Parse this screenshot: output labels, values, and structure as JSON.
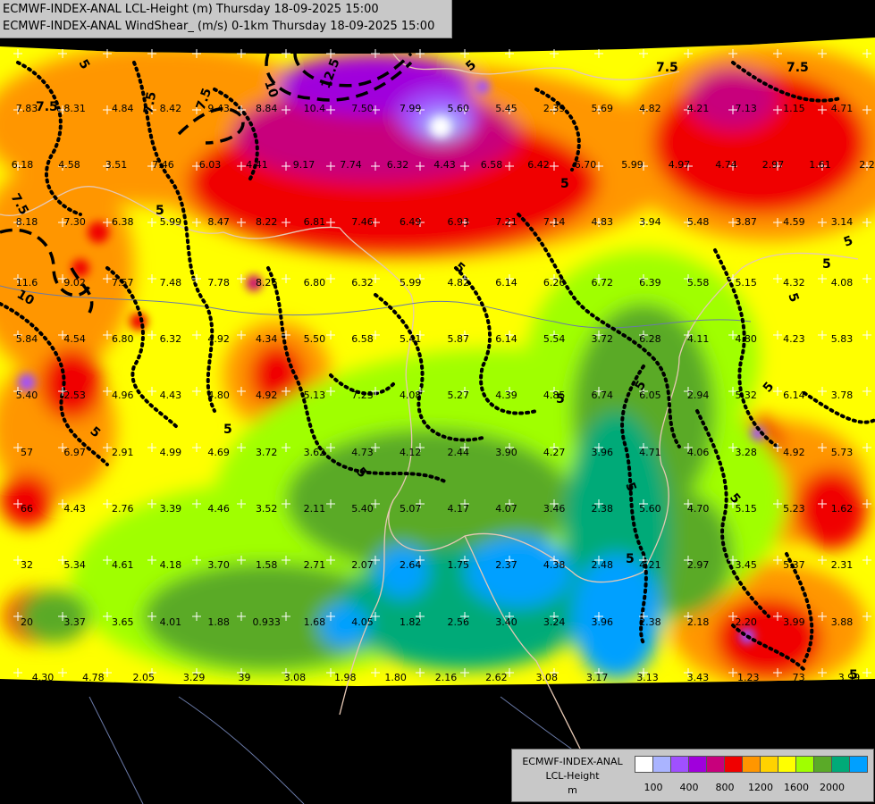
{
  "header": {
    "line1": "ECMWF-INDEX-ANAL LCL-Height (m) Thursday 18-09-2025 15:00",
    "line2": "ECMWF-INDEX-ANAL WindShear_ (m/s) 0-1km Thursday 18-09-2025 15:00"
  },
  "legend": {
    "line1": "ECMWF-INDEX-ANAL",
    "line2": "LCL-Height",
    "line3": "m",
    "colors": [
      "#ffffff",
      "#aab4ff",
      "#a050ff",
      "#a000dc",
      "#c8007c",
      "#f00000",
      "#ff9600",
      "#ffd200",
      "#ffff00",
      "#a0ff00",
      "#5aaa28",
      "#00aa78",
      "#00a0ff"
    ],
    "ticks": [
      "100",
      "400",
      "800",
      "1200",
      "1600",
      "2000"
    ]
  },
  "map": {
    "shear_values": [
      {
        "v": "7.83"
      },
      {
        "v": "8.31"
      },
      {
        "v": "4.84"
      },
      {
        "v": "8.42"
      },
      {
        "v": "9.43"
      },
      {
        "v": "8.84"
      },
      {
        "v": "10.4"
      },
      {
        "v": "7.50"
      },
      {
        "v": "7.99"
      },
      {
        "v": "5.60"
      },
      {
        "v": "5.45"
      },
      {
        "v": "2.39"
      },
      {
        "v": "5.69"
      },
      {
        "v": "4.82"
      },
      {
        "v": "4.21"
      },
      {
        "v": "7.13"
      },
      {
        "v": "1.15"
      },
      {
        "v": "4.71"
      },
      {
        "v": "6.18"
      },
      {
        "v": "4.58"
      },
      {
        "v": "3.51"
      },
      {
        "v": "7.46"
      },
      {
        "v": "6.03"
      },
      {
        "v": "4.41"
      },
      {
        "v": "9.17"
      },
      {
        "v": "7.74"
      },
      {
        "v": "6.32"
      },
      {
        "v": "4.43"
      },
      {
        "v": "6.58"
      },
      {
        "v": "6.42"
      },
      {
        "v": "6.70"
      },
      {
        "v": "5.99"
      },
      {
        "v": "4.97"
      },
      {
        "v": "4.74"
      },
      {
        "v": "2.97"
      },
      {
        "v": "1.61"
      },
      {
        "v": "2.2"
      },
      {
        "v": "8.18"
      },
      {
        "v": "7.30"
      },
      {
        "v": "6.38"
      },
      {
        "v": "5.99"
      },
      {
        "v": "8.47"
      },
      {
        "v": "8.22"
      },
      {
        "v": "6.81"
      },
      {
        "v": "7.46"
      },
      {
        "v": "6.49"
      },
      {
        "v": "6.93"
      },
      {
        "v": "7.21"
      },
      {
        "v": "7.14"
      },
      {
        "v": "4.83"
      },
      {
        "v": "3.94"
      },
      {
        "v": "5.48"
      },
      {
        "v": "3.87"
      },
      {
        "v": "4.59"
      },
      {
        "v": "3.14"
      },
      {
        "v": "11.6"
      },
      {
        "v": "9.02"
      },
      {
        "v": "7.57"
      },
      {
        "v": "7.48"
      },
      {
        "v": "7.78"
      },
      {
        "v": "8.26"
      },
      {
        "v": "6.80"
      },
      {
        "v": "6.32"
      },
      {
        "v": "5.99"
      },
      {
        "v": "4.82"
      },
      {
        "v": "6.14"
      },
      {
        "v": "6.26"
      },
      {
        "v": "6.72"
      },
      {
        "v": "6.39"
      },
      {
        "v": "5.58"
      },
      {
        "v": "5.15"
      },
      {
        "v": "4.32"
      },
      {
        "v": "4.08"
      },
      {
        "v": "5.84"
      },
      {
        "v": "4.54"
      },
      {
        "v": "6.80"
      },
      {
        "v": "6.32"
      },
      {
        "v": "4.92"
      },
      {
        "v": "4.34"
      },
      {
        "v": "5.50"
      },
      {
        "v": "6.58"
      },
      {
        "v": "5.41"
      },
      {
        "v": "5.87"
      },
      {
        "v": "6.14"
      },
      {
        "v": "5.54"
      },
      {
        "v": "3.72"
      },
      {
        "v": "6.28"
      },
      {
        "v": "4.11"
      },
      {
        "v": "4.80"
      },
      {
        "v": "4.23"
      },
      {
        "v": "5.83"
      },
      {
        "v": "5.40"
      },
      {
        "v": "2.53"
      },
      {
        "v": "4.96"
      },
      {
        "v": "4.43"
      },
      {
        "v": "4.80"
      },
      {
        "v": "4.92"
      },
      {
        "v": "5.13"
      },
      {
        "v": "7.23"
      },
      {
        "v": "4.08"
      },
      {
        "v": "5.27"
      },
      {
        "v": "4.39"
      },
      {
        "v": "4.85"
      },
      {
        "v": "6.74"
      },
      {
        "v": "6.05"
      },
      {
        "v": "2.94"
      },
      {
        "v": "5.32"
      },
      {
        "v": "6.14"
      },
      {
        "v": "3.78"
      },
      {
        "v": "57"
      },
      {
        "v": "6.97"
      },
      {
        "v": "2.91"
      },
      {
        "v": "4.99"
      },
      {
        "v": "4.69"
      },
      {
        "v": "3.72"
      },
      {
        "v": "3.62"
      },
      {
        "v": "4.73"
      },
      {
        "v": "4.12"
      },
      {
        "v": "2.44"
      },
      {
        "v": "3.90"
      },
      {
        "v": "4.27"
      },
      {
        "v": "3.96"
      },
      {
        "v": "4.71"
      },
      {
        "v": "4.06"
      },
      {
        "v": "3.28"
      },
      {
        "v": "4.92"
      },
      {
        "v": "5.73"
      },
      {
        "v": "66"
      },
      {
        "v": "4.43"
      },
      {
        "v": "2.76"
      },
      {
        "v": "3.39"
      },
      {
        "v": "4.46"
      },
      {
        "v": "3.52"
      },
      {
        "v": "2.11"
      },
      {
        "v": "5.40"
      },
      {
        "v": "5.07"
      },
      {
        "v": "4.17"
      },
      {
        "v": "4.07"
      },
      {
        "v": "3.46"
      },
      {
        "v": "2.38"
      },
      {
        "v": "5.60"
      },
      {
        "v": "4.70"
      },
      {
        "v": "5.15"
      },
      {
        "v": "5.23"
      },
      {
        "v": "1.62"
      },
      {
        "v": "32"
      },
      {
        "v": "5.34"
      },
      {
        "v": "4.61"
      },
      {
        "v": "4.18"
      },
      {
        "v": "3.70"
      },
      {
        "v": "1.58"
      },
      {
        "v": "2.71"
      },
      {
        "v": "2.07"
      },
      {
        "v": "2.64"
      },
      {
        "v": "1.75"
      },
      {
        "v": "2.37"
      },
      {
        "v": "4.38"
      },
      {
        "v": "2.48"
      },
      {
        "v": "4.21"
      },
      {
        "v": "2.97"
      },
      {
        "v": "3.45"
      },
      {
        "v": "5.37"
      },
      {
        "v": "2.31"
      },
      {
        "v": "20"
      },
      {
        "v": "3.37"
      },
      {
        "v": "3.65"
      },
      {
        "v": "4.01"
      },
      {
        "v": "1.88"
      },
      {
        "v": "0.933"
      },
      {
        "v": "1.68"
      },
      {
        "v": "4.05"
      },
      {
        "v": "1.82"
      },
      {
        "v": "2.56"
      },
      {
        "v": "3.40"
      },
      {
        "v": "3.24"
      },
      {
        "v": "3.96"
      },
      {
        "v": "2.38"
      },
      {
        "v": "2.18"
      },
      {
        "v": "2.20"
      },
      {
        "v": "3.99"
      },
      {
        "v": "3.88"
      },
      {
        "v": "4.30"
      },
      {
        "v": "4.78"
      },
      {
        "v": "2.05"
      },
      {
        "v": "3.29"
      },
      {
        "v": "39"
      },
      {
        "v": "3.08"
      },
      {
        "v": "1.98"
      },
      {
        "v": "1.80"
      },
      {
        "v": "2.16"
      },
      {
        "v": "2.62"
      },
      {
        "v": "3.08"
      },
      {
        "v": "3.17"
      },
      {
        "v": "3.13"
      },
      {
        "v": "3.43"
      },
      {
        "v": "1.23"
      },
      {
        "v": "73"
      },
      {
        "v": "3.99"
      }
    ],
    "contour_labels": [
      "7.5",
      "7.5",
      "10",
      "12.5",
      "5",
      "7.5",
      "7.5",
      "5",
      "5",
      "7.5",
      "10",
      "5",
      "7.5",
      "5",
      "5",
      "5",
      "5",
      "5",
      "5",
      "5",
      "5",
      "5",
      "5",
      "5",
      "5",
      "5",
      "5"
    ]
  }
}
